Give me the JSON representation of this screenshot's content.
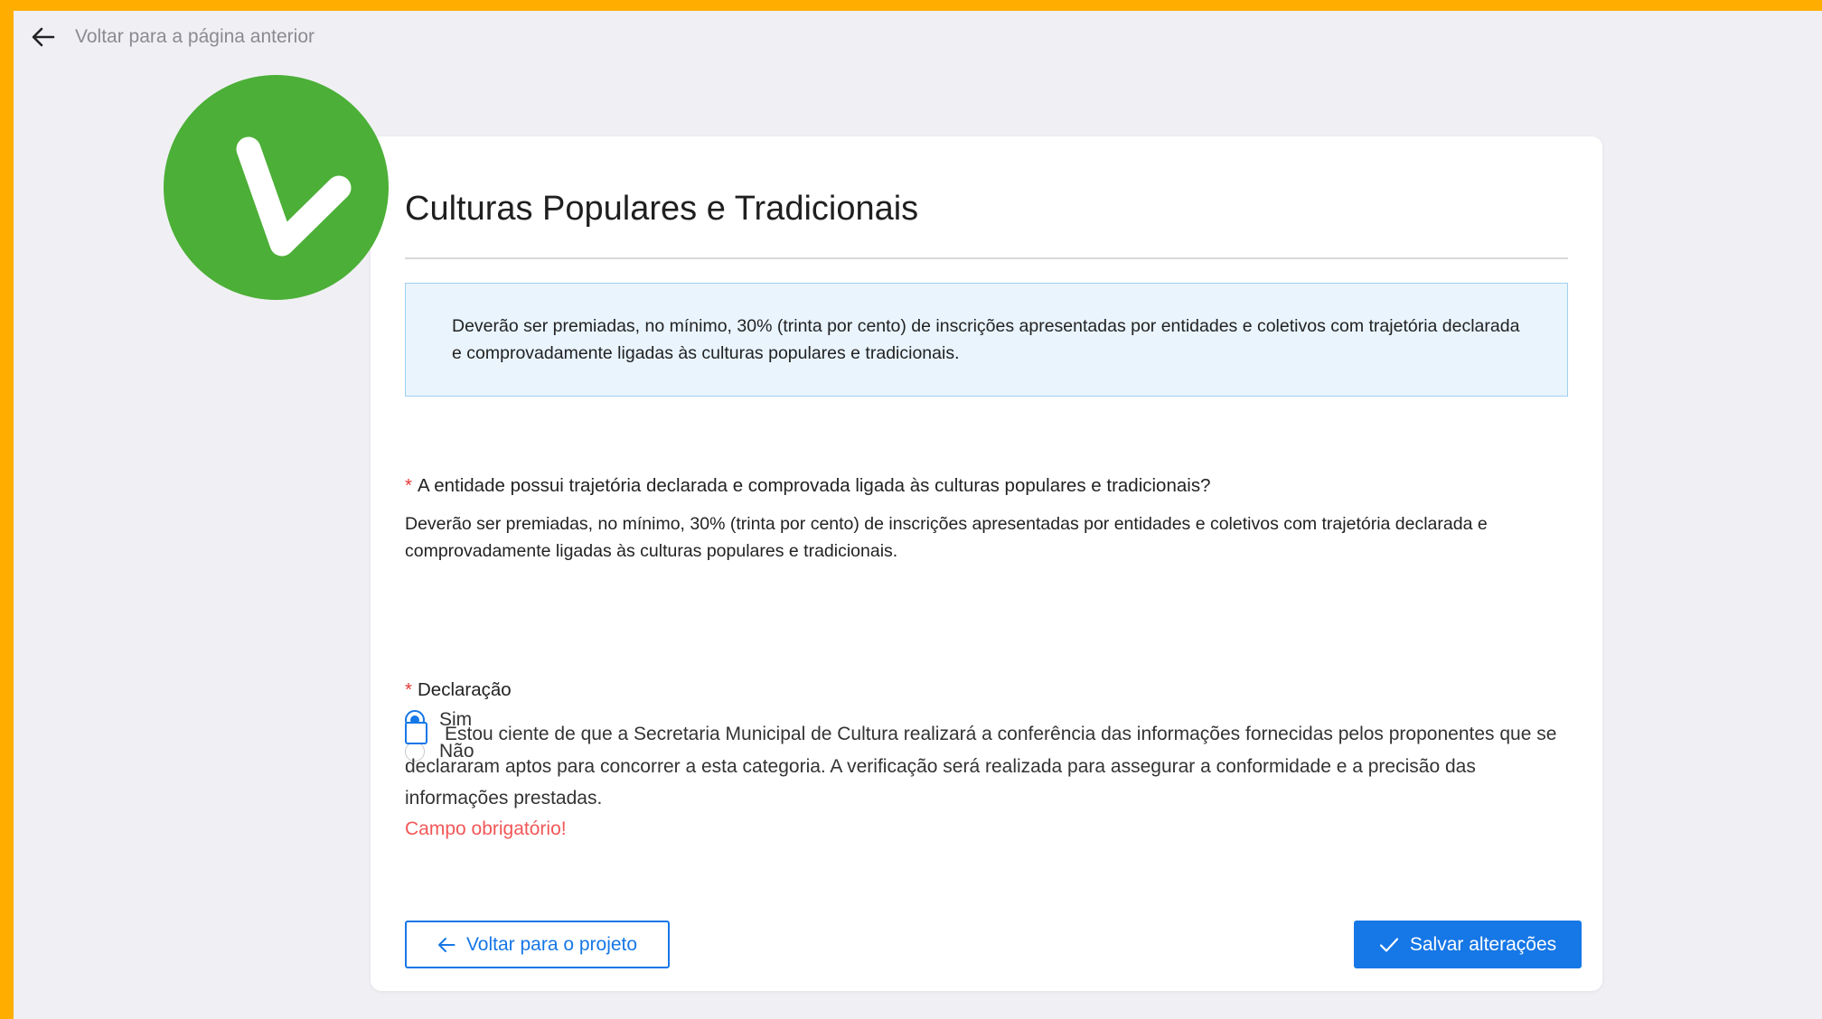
{
  "nav": {
    "back_label": "Voltar para a página anterior"
  },
  "form": {
    "title": "Culturas Populares e Tradicionais",
    "info_text": "Deverão ser premiadas, no mínimo, 30% (trinta por cento) de inscrições apresentadas por entidades e coletivos com trajetória declarada e comprovadamente ligadas às culturas populares e tradicionais.",
    "question": {
      "required_mark": "*",
      "label": "A entidade possui trajetória declarada e comprovada ligada às culturas populares e tradicionais?",
      "help": "Deverão ser premiadas, no mínimo, 30% (trinta por cento) de inscrições apresentadas por entidades e coletivos com trajetória declarada e comprovadamente ligadas às culturas populares e tradicionais.",
      "options": [
        "Sim",
        "Não"
      ],
      "selected": "Sim"
    },
    "declaration": {
      "required_mark": "*",
      "label": "Declaração",
      "checked": false,
      "text": "Estou ciente de que a Secretaria Municipal de Cultura realizará a conferência das informações fornecidas pelos proponentes que se declararam aptos para concorrer a esta categoria. A verificação será realizada para assegurar a conformidade e a precisão das informações prestadas.",
      "error": "Campo obrigatório!"
    },
    "buttons": {
      "back_label": "Voltar para o projeto",
      "save_label": "Salvar alterações"
    }
  },
  "icons": {
    "top_back": "arrow-left-icon",
    "badge": "arrow-down-right-icon",
    "back_button": "arrow-left-icon",
    "save_button": "check-icon"
  },
  "colors": {
    "frame": "#FFAE00",
    "page_background": "#F0F0F4",
    "primary": "#1677E6",
    "badge_green": "#4CAF37",
    "info_background": "#E9F4FD",
    "info_border": "#9FD0F2",
    "error": "#F25757",
    "required": "#E53935"
  }
}
